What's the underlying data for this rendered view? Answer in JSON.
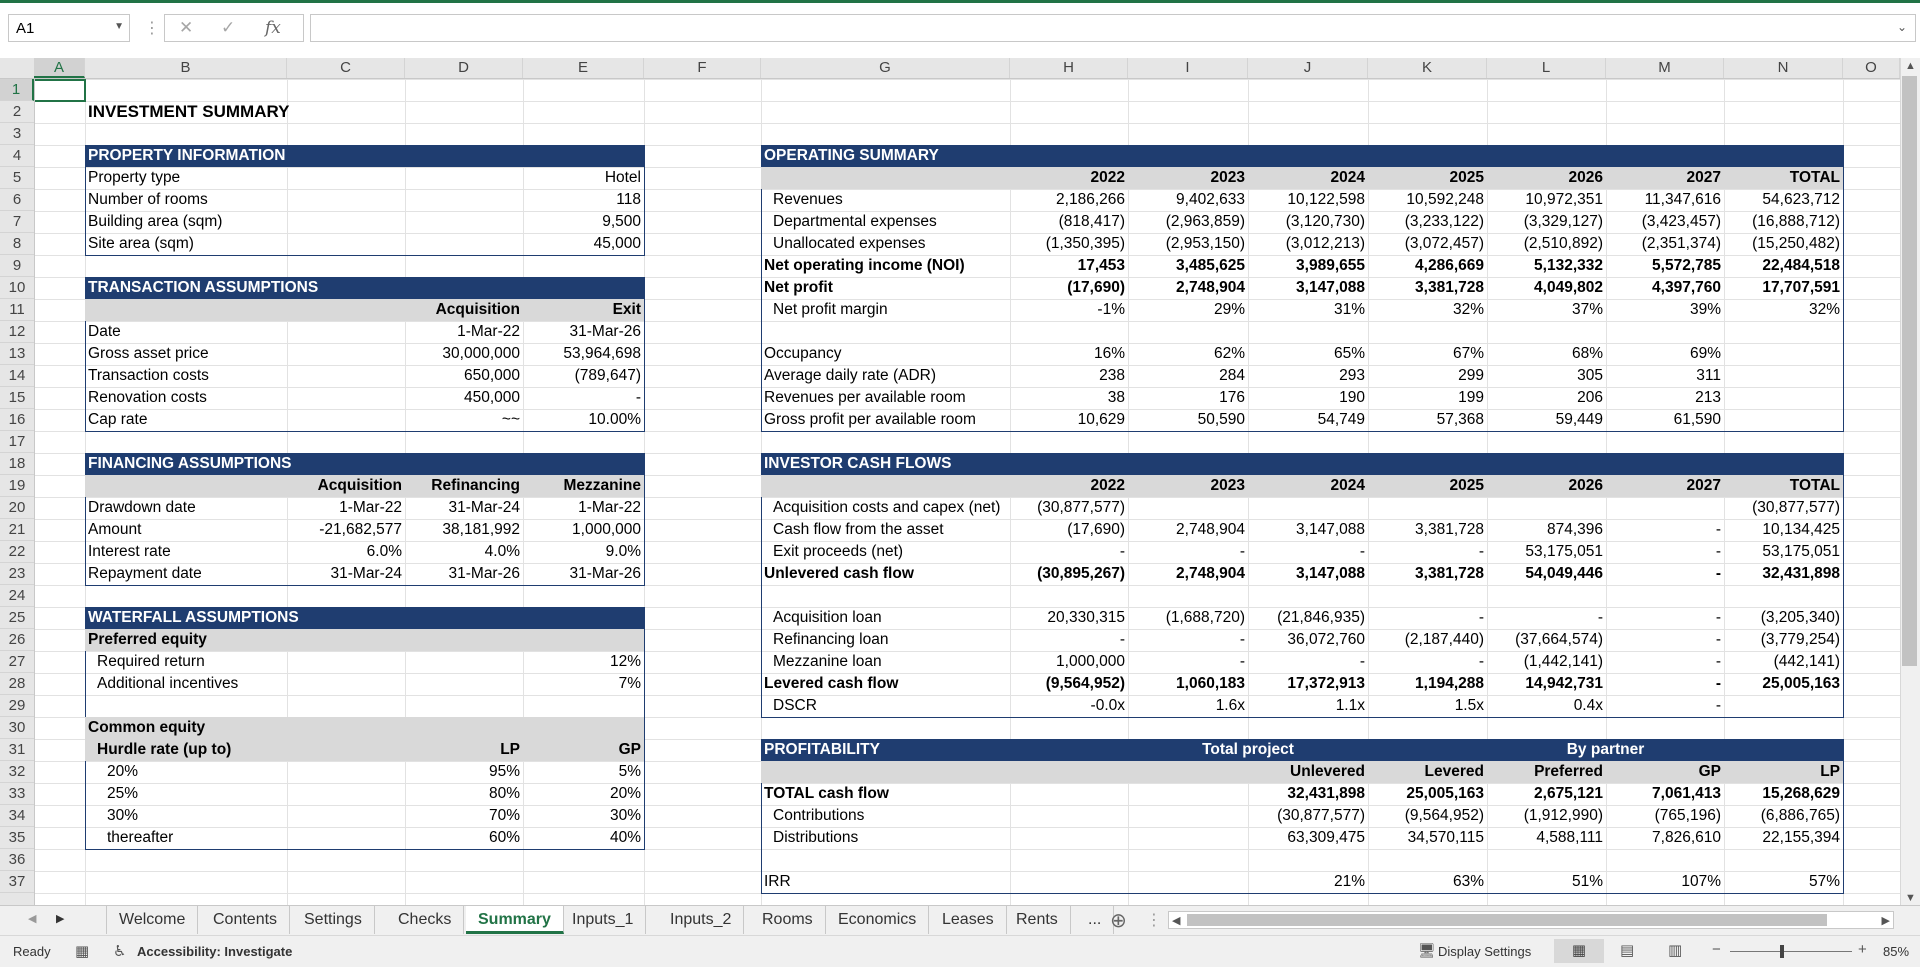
{
  "formula_bar": {
    "name_box": "A1",
    "cancel_icon": "✕",
    "enter_icon": "✓",
    "fx_label": "fx",
    "formula": ""
  },
  "columns": [
    "A",
    "B",
    "C",
    "D",
    "E",
    "F",
    "G",
    "H",
    "I",
    "J",
    "K",
    "L",
    "M",
    "N",
    "O"
  ],
  "rows": [
    "1",
    "2",
    "3",
    "4",
    "5",
    "6",
    "7",
    "8",
    "9",
    "10",
    "11",
    "12",
    "13",
    "14",
    "15",
    "16",
    "17",
    "18",
    "19",
    "20",
    "21",
    "22",
    "23",
    "24",
    "25",
    "26",
    "27",
    "28",
    "29",
    "30",
    "31",
    "32",
    "33",
    "34",
    "35",
    "36",
    "37"
  ],
  "sheet": {
    "title": "INVESTMENT SUMMARY",
    "property": {
      "header": "PROPERTY INFORMATION",
      "rows": [
        {
          "label": "Property type",
          "value": "Hotel"
        },
        {
          "label": "Number of rooms",
          "value": "118"
        },
        {
          "label": "Building area (sqm)",
          "value": "9,500"
        },
        {
          "label": "Site area (sqm)",
          "value": "45,000"
        }
      ]
    },
    "transaction": {
      "header": "TRANSACTION ASSUMPTIONS",
      "col_acq": "Acquisition",
      "col_exit": "Exit",
      "rows": [
        {
          "label": "Date",
          "acq": "1-Mar-22",
          "exit": "31-Mar-26"
        },
        {
          "label": "Gross asset price",
          "acq": "30,000,000",
          "exit": "53,964,698"
        },
        {
          "label": "Transaction costs",
          "acq": "650,000",
          "exit": "(789,647)"
        },
        {
          "label": "Renovation costs",
          "acq": "450,000",
          "exit": "-"
        },
        {
          "label": "Cap rate",
          "acq": "~~",
          "exit": "10.00%"
        }
      ]
    },
    "financing": {
      "header": "FINANCING ASSUMPTIONS",
      "cols": [
        "Acquisition",
        "Refinancing",
        "Mezzanine"
      ],
      "rows": [
        {
          "label": "Drawdown date",
          "v": [
            "1-Mar-22",
            "31-Mar-24",
            "1-Mar-22"
          ]
        },
        {
          "label": "Amount",
          "v": [
            "-21,682,577",
            "38,181,992",
            "1,000,000"
          ]
        },
        {
          "label": "Interest rate",
          "v": [
            "6.0%",
            "4.0%",
            "9.0%"
          ]
        },
        {
          "label": "Repayment date",
          "v": [
            "31-Mar-24",
            "31-Mar-26",
            "31-Mar-26"
          ]
        }
      ]
    },
    "waterfall": {
      "header": "WATERFALL ASSUMPTIONS",
      "preferred": "Preferred equity",
      "required_return_label": "Required return",
      "required_return": "12%",
      "incentives_label": "Additional incentives",
      "incentives": "7%",
      "common": "Common equity",
      "hurdle_label": "Hurdle rate (up to)",
      "col_lp": "LP",
      "col_gp": "GP",
      "hurdles": [
        {
          "rate": "20%",
          "lp": "95%",
          "gp": "5%"
        },
        {
          "rate": "25%",
          "lp": "80%",
          "gp": "20%"
        },
        {
          "rate": "30%",
          "lp": "70%",
          "gp": "30%"
        },
        {
          "rate": "thereafter",
          "lp": "60%",
          "gp": "40%"
        }
      ]
    },
    "operating": {
      "header": "OPERATING SUMMARY",
      "years": [
        "2022",
        "2023",
        "2024",
        "2025",
        "2026",
        "2027",
        "TOTAL"
      ],
      "rows": [
        {
          "label": "Revenues",
          "indent": true,
          "bold": false,
          "v": [
            "2,186,266",
            "9,402,633",
            "10,122,598",
            "10,592,248",
            "10,972,351",
            "11,347,616",
            "54,623,712"
          ]
        },
        {
          "label": "Departmental expenses",
          "indent": true,
          "bold": false,
          "v": [
            "(818,417)",
            "(2,963,859)",
            "(3,120,730)",
            "(3,233,122)",
            "(3,329,127)",
            "(3,423,457)",
            "(16,888,712)"
          ]
        },
        {
          "label": "Unallocated expenses",
          "indent": true,
          "bold": false,
          "v": [
            "(1,350,395)",
            "(2,953,150)",
            "(3,012,213)",
            "(3,072,457)",
            "(2,510,892)",
            "(2,351,374)",
            "(15,250,482)"
          ]
        },
        {
          "label": "Net operating income (NOI)",
          "indent": false,
          "bold": true,
          "v": [
            "17,453",
            "3,485,625",
            "3,989,655",
            "4,286,669",
            "5,132,332",
            "5,572,785",
            "22,484,518"
          ]
        },
        {
          "label": "Net profit",
          "indent": false,
          "bold": true,
          "v": [
            "(17,690)",
            "2,748,904",
            "3,147,088",
            "3,381,728",
            "4,049,802",
            "4,397,760",
            "17,707,591"
          ]
        },
        {
          "label": "Net profit margin",
          "indent": true,
          "bold": false,
          "v": [
            "-1%",
            "29%",
            "31%",
            "32%",
            "37%",
            "39%",
            "32%"
          ]
        }
      ],
      "kpis": [
        {
          "label": "Occupancy",
          "v": [
            "16%",
            "62%",
            "65%",
            "67%",
            "68%",
            "69%"
          ]
        },
        {
          "label": "Average daily rate (ADR)",
          "v": [
            "238",
            "284",
            "293",
            "299",
            "305",
            "311"
          ]
        },
        {
          "label": "Revenues per available room",
          "v": [
            "38",
            "176",
            "190",
            "199",
            "206",
            "213"
          ]
        },
        {
          "label": "Gross profit per available room",
          "v": [
            "10,629",
            "50,590",
            "54,749",
            "57,368",
            "59,449",
            "61,590"
          ]
        }
      ]
    },
    "cashflows": {
      "header": "INVESTOR CASH FLOWS",
      "years": [
        "2022",
        "2023",
        "2024",
        "2025",
        "2026",
        "2027",
        "TOTAL"
      ],
      "rows": [
        {
          "label": "Acquisition costs and capex (net)",
          "indent": true,
          "bold": false,
          "v": [
            "(30,877,577)",
            "",
            "",
            "",
            "",
            "",
            "(30,877,577)"
          ]
        },
        {
          "label": "Cash flow from the asset",
          "indent": true,
          "bold": false,
          "v": [
            "(17,690)",
            "2,748,904",
            "3,147,088",
            "3,381,728",
            "874,396",
            "-",
            "10,134,425"
          ]
        },
        {
          "label": "Exit proceeds (net)",
          "indent": true,
          "bold": false,
          "v": [
            "-",
            "-",
            "-",
            "-",
            "53,175,051",
            "-",
            "53,175,051"
          ]
        },
        {
          "label": "Unlevered cash flow",
          "indent": false,
          "bold": true,
          "v": [
            "(30,895,267)",
            "2,748,904",
            "3,147,088",
            "3,381,728",
            "54,049,446",
            "-",
            "32,431,898"
          ]
        }
      ],
      "loans": [
        {
          "label": "Acquisition loan",
          "indent": true,
          "bold": false,
          "v": [
            "20,330,315",
            "(1,688,720)",
            "(21,846,935)",
            "-",
            "-",
            "-",
            "(3,205,340)"
          ]
        },
        {
          "label": "Refinancing loan",
          "indent": true,
          "bold": false,
          "v": [
            "-",
            "-",
            "36,072,760",
            "(2,187,440)",
            "(37,664,574)",
            "-",
            "(3,779,254)"
          ]
        },
        {
          "label": "Mezzanine loan",
          "indent": true,
          "bold": false,
          "v": [
            "1,000,000",
            "-",
            "-",
            "-",
            "(1,442,141)",
            "-",
            "(442,141)"
          ]
        },
        {
          "label": "Levered cash flow",
          "indent": false,
          "bold": true,
          "v": [
            "(9,564,952)",
            "1,060,183",
            "17,372,913",
            "1,194,288",
            "14,942,731",
            "-",
            "25,005,163"
          ]
        },
        {
          "label": "DSCR",
          "indent": true,
          "bold": false,
          "v": [
            "-0.0x",
            "1.6x",
            "1.1x",
            "1.5x",
            "0.4x",
            "-",
            ""
          ]
        }
      ]
    },
    "profitability": {
      "header": "PROFITABILITY",
      "group_total": "Total project",
      "group_partner": "By partner",
      "cols": [
        "Unlevered",
        "Levered",
        "Preferred",
        "GP",
        "LP"
      ],
      "rows": [
        {
          "label": "TOTAL cash flow",
          "indent": false,
          "bold": true,
          "v": [
            "32,431,898",
            "25,005,163",
            "2,675,121",
            "7,061,413",
            "15,268,629"
          ]
        },
        {
          "label": "Contributions",
          "indent": true,
          "bold": false,
          "v": [
            "(30,877,577)",
            "(9,564,952)",
            "(1,912,990)",
            "(765,196)",
            "(6,886,765)"
          ]
        },
        {
          "label": "Distributions",
          "indent": true,
          "bold": false,
          "v": [
            "63,309,475",
            "34,570,115",
            "4,588,111",
            "7,826,610",
            "22,155,394"
          ]
        }
      ],
      "irr_label": "IRR",
      "irr": [
        "21%",
        "63%",
        "51%",
        "107%",
        "57%"
      ]
    }
  },
  "tabs": [
    "Welcome",
    "Contents",
    "Settings",
    "Checks",
    "Summary",
    "Inputs_1",
    "Inputs_2",
    "Rooms",
    "Economics",
    "Leases",
    "Rents",
    "..."
  ],
  "active_tab": "Summary",
  "status": {
    "ready": "Ready",
    "accessibility": "Accessibility: Investigate",
    "display_settings": "Display Settings",
    "zoom": "85%"
  },
  "colors": {
    "header_band": "#1f3d70",
    "accent": "#217346",
    "subheader_gray": "#d9d9d9"
  }
}
